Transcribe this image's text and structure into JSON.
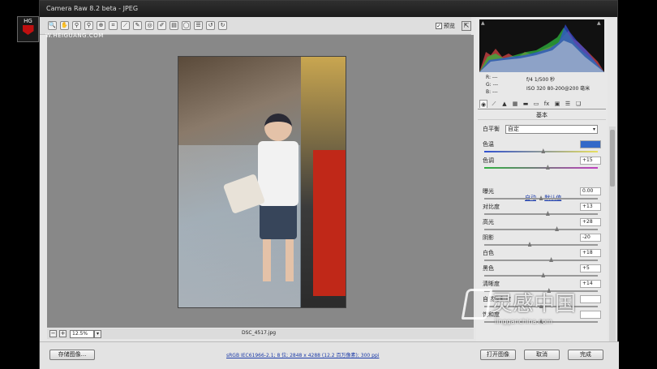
{
  "app": {
    "title": "Camera Raw 8.2 beta - JPEG"
  },
  "overlay": {
    "brand_top": "HG",
    "brand_url": "W.HEIGUANG.COM"
  },
  "toolbar": {
    "tools": [
      "zoom-icon",
      "hand-icon",
      "white-balance-icon",
      "color-sampler-icon",
      "target-adjust-icon",
      "crop-icon",
      "straighten-icon",
      "spot-removal-icon",
      "red-eye-icon",
      "adjust-brush-icon",
      "graduated-filter-icon",
      "radial-filter-icon",
      "preferences-icon",
      "rotate-ccw-icon",
      "rotate-cw-icon"
    ],
    "preview_label": "预览",
    "preview_checked": true
  },
  "status": {
    "zoom": "12.5%",
    "filename": "DSC_4517.jpg"
  },
  "bottom": {
    "save_label": "存储图像...",
    "info_link": "sRGB IEC61966-2.1; 8 位; 2848 x 4288 (12.2 百万像素); 300 ppi",
    "open_label": "打开图像",
    "cancel_label": "取消",
    "done_label": "完成"
  },
  "info": {
    "r": "R:  ---",
    "g": "G:  ---",
    "b": "B:  ---",
    "aperture_shutter": "f/4   1/500 秒",
    "iso_lens": "ISO 320   80-200@200 毫米"
  },
  "panel": {
    "tabs": [
      "basic-icon",
      "tone-curve-icon",
      "detail-icon",
      "hsl-icon",
      "split-toning-icon",
      "lens-icon",
      "effects-icon",
      "camera-calibration-icon",
      "presets-icon",
      "snapshots-icon"
    ],
    "title": "基本",
    "wb_label": "白平衡",
    "wb_value": "自定",
    "auto_label": "自动",
    "default_label": "默认值",
    "sliders_top": [
      {
        "label": "色温",
        "value": "",
        "pos": 0.52,
        "selected": true
      },
      {
        "label": "色调",
        "value": "+15",
        "pos": 0.56,
        "selected": false
      }
    ],
    "sliders": [
      {
        "label": "曝光",
        "value": "0.00",
        "pos": 0.5
      },
      {
        "label": "对比度",
        "value": "+13",
        "pos": 0.56
      },
      {
        "label": "高光",
        "value": "+28",
        "pos": 0.64
      },
      {
        "label": "阴影",
        "value": "-20",
        "pos": 0.4
      },
      {
        "label": "白色",
        "value": "+18",
        "pos": 0.59
      },
      {
        "label": "黑色",
        "value": "+5",
        "pos": 0.52
      },
      {
        "label": "清晰度",
        "value": "+14",
        "pos": 0.57
      },
      {
        "label": "自然饱和度",
        "value": "",
        "pos": 0.5
      },
      {
        "label": "饱和度",
        "value": "",
        "pos": 0.5
      }
    ]
  },
  "watermark": {
    "big": "灵感中国",
    "small": "lingganchina.com"
  }
}
